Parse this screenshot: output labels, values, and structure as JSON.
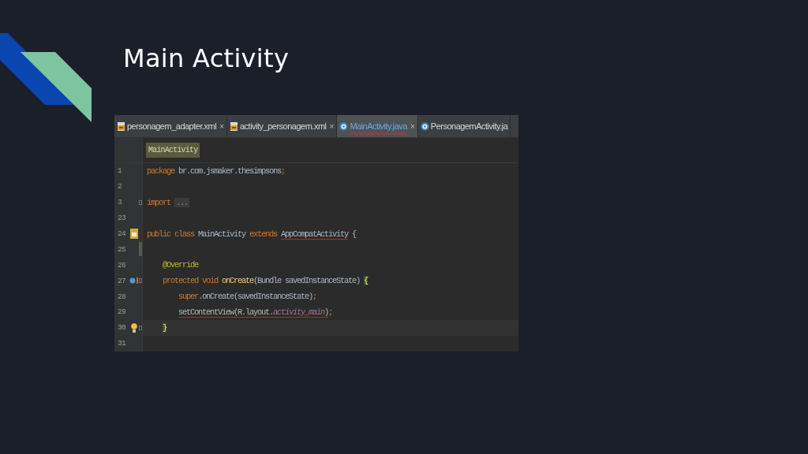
{
  "slide": {
    "title": "Main Activity"
  },
  "editor": {
    "tabs": [
      {
        "label": "personagem_adapter.xml",
        "kind": "xml",
        "selected": false,
        "error": false,
        "close": "×"
      },
      {
        "label": "activity_personagem.xml",
        "kind": "xml",
        "selected": false,
        "error": false,
        "close": "×"
      },
      {
        "label": "MainActivity.java",
        "kind": "class",
        "selected": true,
        "error": true,
        "close": "×"
      },
      {
        "label": "PersonagemActivity.ja",
        "kind": "class",
        "selected": false,
        "error": false
      }
    ],
    "breadcrumb": "MainActivity",
    "lines": [
      {
        "number": "1",
        "segments": [
          {
            "kind": "kw",
            "text": "package"
          },
          {
            "kind": "plain",
            "text": " br.com.jsmaker.thesimpsons"
          },
          {
            "kind": "kw",
            "text": ";"
          }
        ]
      },
      {
        "number": "2"
      },
      {
        "number": "3",
        "markers": [
          {
            "kind": "fold-start"
          }
        ],
        "segments": [
          {
            "kind": "kw",
            "text": "import "
          },
          {
            "kind": "folded",
            "text": "..."
          }
        ]
      },
      {
        "number": "23"
      },
      {
        "number": "24",
        "markers": [
          {
            "kind": "class"
          }
        ],
        "segments": [
          {
            "kind": "kw",
            "text": "public class"
          },
          {
            "kind": "plain",
            "text": " MainActivity "
          },
          {
            "kind": "kw",
            "text": "extends "
          },
          {
            "kind": "plain",
            "text": "AppCompatActivity",
            "error": true
          },
          {
            "kind": "plain",
            "text": " {"
          }
        ],
        "children": [
          {
            "number": "25",
            "markers": [
              {
                "kind": "scope-bar"
              }
            ]
          },
          {
            "number": "26",
            "segments": [
              {
                "kind": "annotation",
                "text": "@Override"
              }
            ]
          },
          {
            "number": "27",
            "markers": [
              {
                "kind": "override"
              },
              {
                "kind": "fold-start"
              }
            ],
            "segments": [
              {
                "kind": "kw",
                "text": "protected void "
              },
              {
                "kind": "method",
                "text": "onCreate"
              },
              {
                "kind": "plain",
                "text": "(Bundle savedInstanceState) "
              },
              {
                "kind": "brace",
                "text": "{"
              }
            ],
            "children": [
              {
                "number": "28",
                "segments": [
                  {
                    "kind": "kw",
                    "text": "super"
                  },
                  {
                    "kind": "plain",
                    "text": ".onCreate(savedInstanceState)"
                  },
                  {
                    "kind": "kw",
                    "text": ";"
                  }
                ]
              },
              {
                "number": "29",
                "segments": [
                  {
                    "kind": "plain",
                    "text": "setContentView(R.layout.",
                    "error": true
                  },
                  {
                    "kind": "field",
                    "text": "activity_main",
                    "error": true
                  },
                  {
                    "kind": "plain",
                    "text": ")",
                    "error": true
                  },
                  {
                    "kind": "kw",
                    "text": ";"
                  }
                ]
              }
            ]
          },
          {
            "number": "30",
            "markers": [
              {
                "kind": "bulb"
              },
              {
                "kind": "fold-end"
              }
            ],
            "current": true,
            "segments": [
              {
                "kind": "brace",
                "text": "}"
              }
            ]
          }
        ]
      },
      {
        "number": "31"
      }
    ]
  }
}
